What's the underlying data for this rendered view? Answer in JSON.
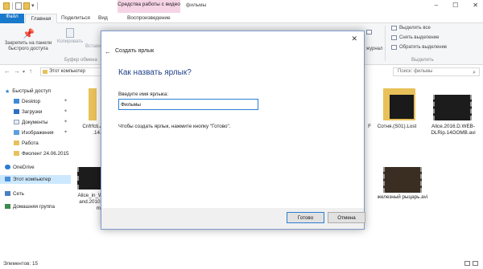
{
  "window": {
    "context_tab": "Средства работы с видео",
    "title": "фильмы",
    "minimize_icon": "minimize-icon",
    "maximize_icon": "maximize-icon",
    "close_icon": "close-icon"
  },
  "ribbon_tabs": {
    "file": "Файл",
    "home": "Главная",
    "share": "Поделиться",
    "view": "Вид",
    "play": "Воспроизведение"
  },
  "ribbon": {
    "pin_label": "Закрепить на панели быстрого доступа",
    "copy_label": "Копировать",
    "paste_label": "Вставить",
    "clipboard_group": "Буфер обмена",
    "journal_label": "журнал",
    "select_all": "Выделить все",
    "select_none": "Снять выделение",
    "invert_selection": "Обратить выделение",
    "select_group": "Выделить"
  },
  "address": {
    "path": "Этот компьютер",
    "search_placeholder": "Поиск: фильмы"
  },
  "nav": {
    "quick_access": "Быстрый доступ",
    "desktop": "Desktop",
    "downloads": "Загрузки",
    "documents": "Документы",
    "pictures": "Изображения",
    "work": "Работа",
    "fiolent": "Фиолент 24.06.2015",
    "onedrive": "OneDrive",
    "this_pc": "Этот компьютер",
    "network": "Сеть",
    "homegroup": "Домашняя группа"
  },
  "files": {
    "f1": "Cnfrfcti.AI",
    ".f1_2": ".14.E",
    "f1_2": ".14.E",
    "f2_left": "F",
    "f3": "Сотня.(S01).Lost",
    "f4": "Alice.2016.D.WEB-DLRip.14OOMB.avi",
    "f5": "Alice_in_W",
    "f5_2": "and.2010.I",
    "f5_3": "mk",
    "f6": "железный рыцарь.avi"
  },
  "status": {
    "items": "Элементов: 15"
  },
  "dialog": {
    "title": "Создать ярлык",
    "heading": "Как назвать ярлык?",
    "label": "Введите имя ярлыка:",
    "input_value": "Фильмы",
    "note": "Чтобы создать ярлык, нажмите кнопку \"Готово\".",
    "ok": "Готово",
    "cancel": "Отмена"
  }
}
